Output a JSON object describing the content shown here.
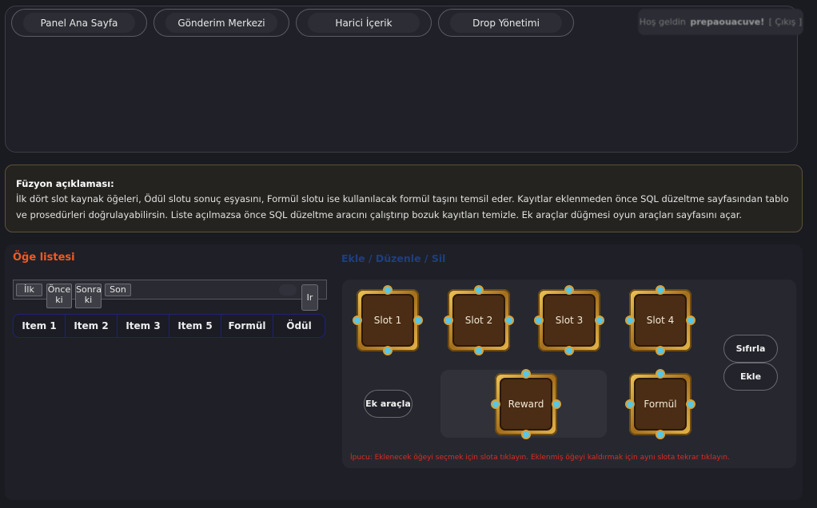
{
  "nav": {
    "tabs": [
      {
        "label": "Panel Ana Sayfa"
      },
      {
        "label": "Gönderim Merkezi"
      },
      {
        "label": "Harici İçerik"
      },
      {
        "label": "Drop Yönetimi"
      }
    ],
    "welcome": {
      "prefix": "Hoş geldin",
      "user": "prepaouacuve!",
      "logout": "[ Çıkış ]"
    }
  },
  "info": {
    "title": "Füzyon açıklaması:",
    "body": "İlk dört slot kaynak öğeleri, Ödül slotu sonuç eşyasını, Formül slotu ise kullanılacak formül taşını temsil eder. Kayıtlar eklenmeden önce SQL düzeltme sayfasından tablo ve prosedürleri doğrulayabilirsin. Liste açılmazsa önce SQL düzeltme aracını çalıştırıp bozuk kayıtları temizle. Ek araçlar düğmesi oyun araçları sayfasını açar."
  },
  "list": {
    "title": "Öğe listesi",
    "pager": {
      "first": "İlk",
      "prev": "Önce ki",
      "next": "Sonra ki",
      "last": "Son",
      "go": "Ir"
    },
    "columns": [
      "Item 1",
      "Item 2",
      "Item 3",
      "Item 5",
      "Formül",
      "Ödül"
    ]
  },
  "editor": {
    "title": "Ekle / Düzenle / Sil",
    "slots": {
      "s1": "Slot 1",
      "s2": "Slot 2",
      "s3": "Slot 3",
      "s4": "Slot 4",
      "reward": "Reward",
      "formula": "Formül"
    },
    "buttons": {
      "reset": "Sıfırla",
      "add": "Ekle",
      "tools": "Ek araçla"
    },
    "tip": "İpucu: Eklenecek öğeyi seçmek için slota tıklayın. Eklenmiş öğeyi kaldırmak için aynı slota tekrar tıklayın."
  },
  "colors": {
    "list_title": "#f25a1e",
    "editor_title": "#1d3f82",
    "tip": "#e02a1f",
    "slot_gold": "#d4a23c",
    "slot_gem": "#58c7e6"
  }
}
